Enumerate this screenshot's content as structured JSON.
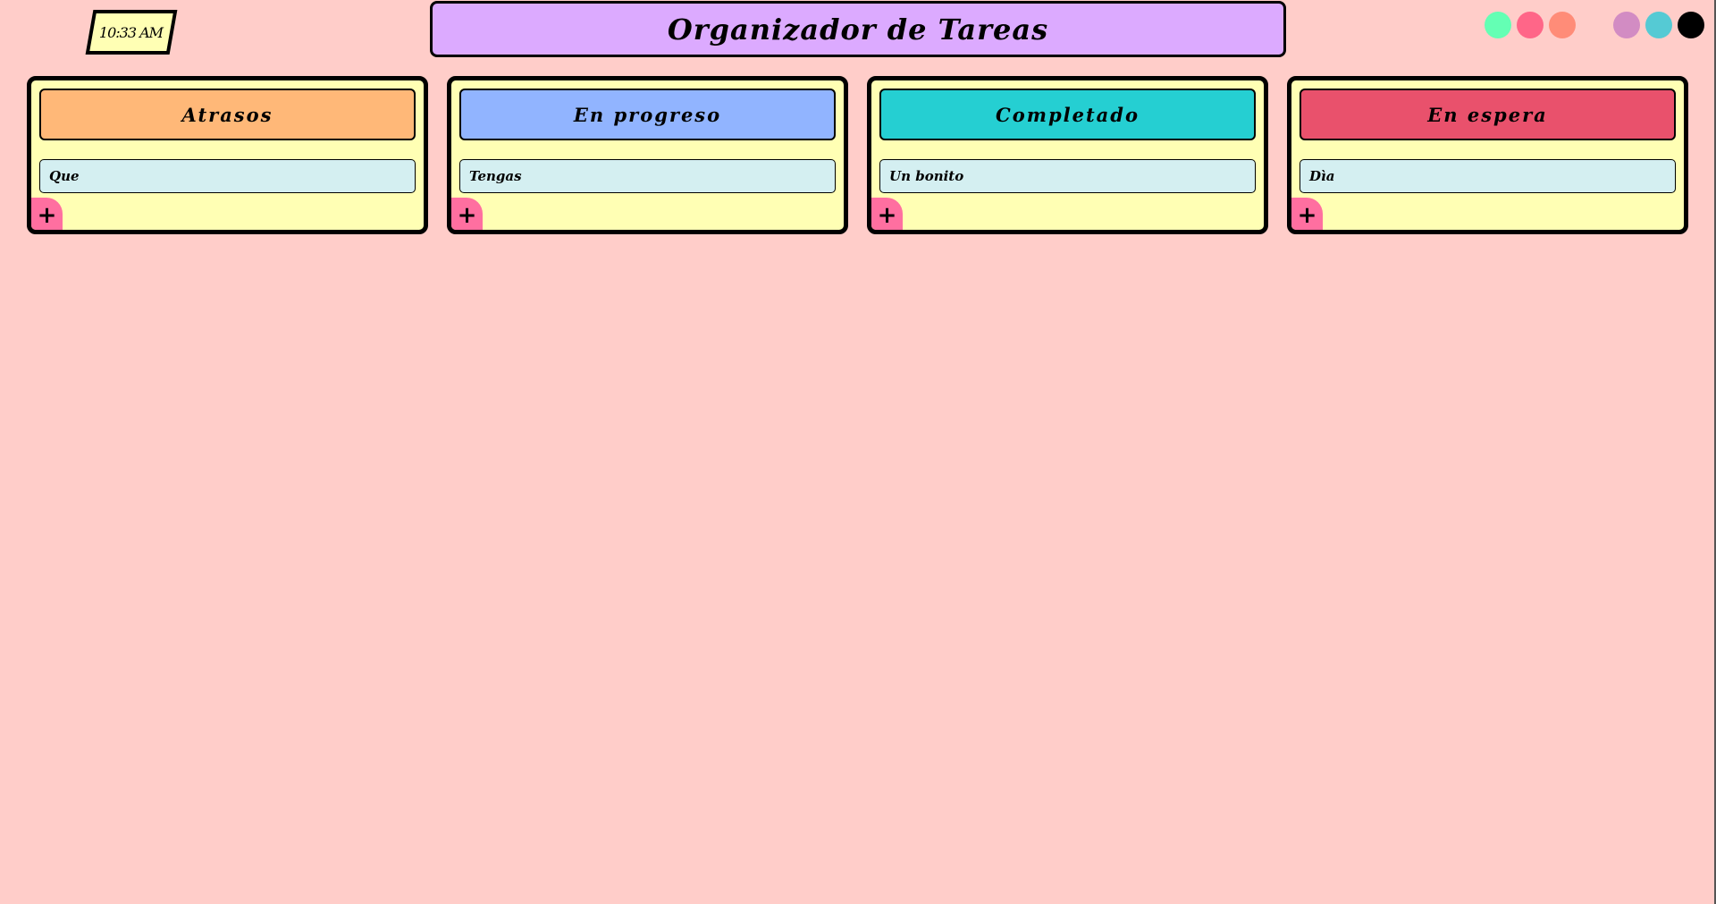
{
  "clock": "10:33 AM",
  "title": "Organizador de Tareas",
  "theme_colors": [
    "#64ffb4",
    "#ff6688",
    "#ff8c78",
    "#d28cc3",
    "#55cad4",
    "#000000"
  ],
  "columns": [
    {
      "title": "Atrasos",
      "color": "#ffb878",
      "tasks": [
        "Que"
      ]
    },
    {
      "title": "En progreso",
      "color": "#91b4ff",
      "tasks": [
        "Tengas"
      ]
    },
    {
      "title": "Completado",
      "color": "#25cfd2",
      "tasks": [
        "Un bonito"
      ]
    },
    {
      "title": "En espera",
      "color": "#e9516c",
      "tasks": [
        "Dìa"
      ]
    }
  ],
  "add_label": "+"
}
